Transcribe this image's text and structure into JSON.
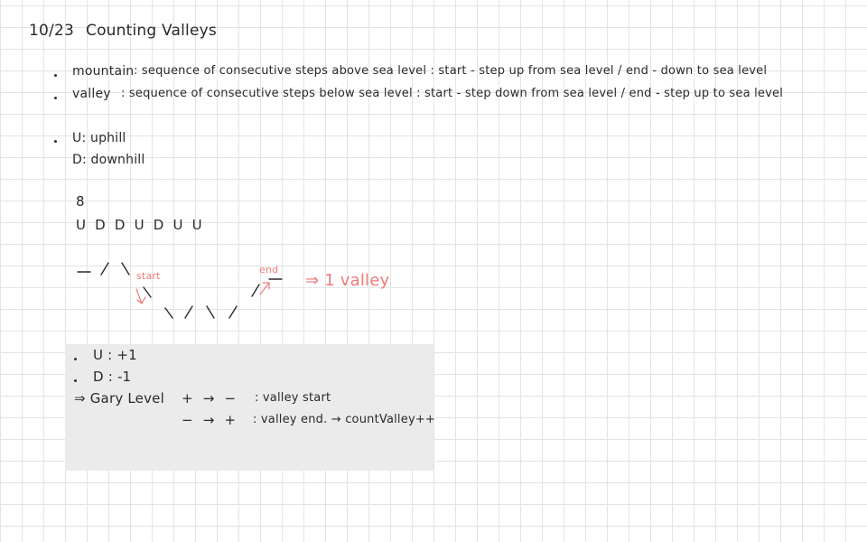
{
  "note": {
    "date": "10/23",
    "title": "Counting Valleys",
    "definitions": [
      {
        "term": "mountain",
        "text": ": sequence of consecutive steps above sea level : start - step up from sea level / end - down to sea level"
      },
      {
        "term": "valley",
        "text": ": sequence of consecutive steps below sea level : start - step down from sea level / end - step up to sea level"
      }
    ],
    "legend": [
      "U: uphill",
      "D: downhill"
    ],
    "sample_n": "8",
    "sample_steps": "U D D U D U U",
    "diagram": {
      "start_label": "start",
      "end_label": "end",
      "result": "⇒ 1 valley"
    },
    "rules": {
      "u_rule": "U : +1",
      "d_rule": "D : -1",
      "level_prefix": "⇒ Gary Level",
      "start_rule": "+ → −",
      "start_desc": ": valley start",
      "end_rule": "− → +",
      "end_desc": ": valley end. → countValley++"
    },
    "colors": {
      "ink": "#2a2a2a",
      "accent": "#ef7a7a",
      "highlight": "#ebebeb"
    }
  }
}
